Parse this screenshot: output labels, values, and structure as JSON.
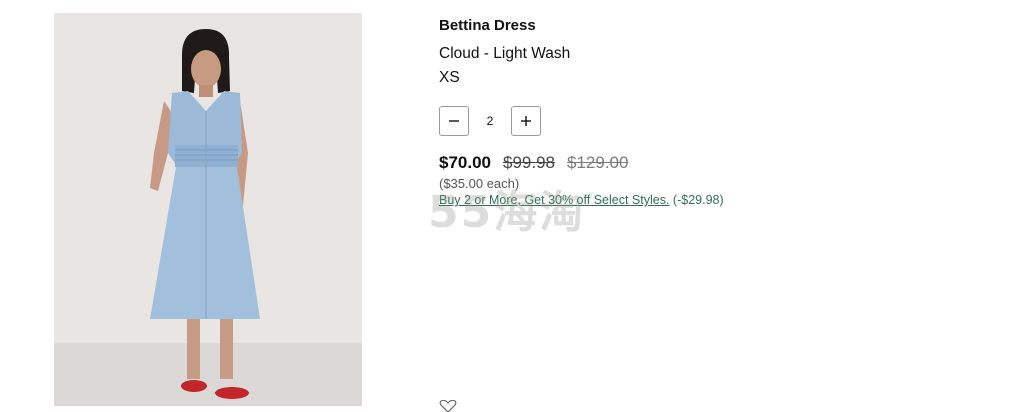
{
  "product": {
    "name": "Bettina Dress",
    "color": "Cloud - Light Wash",
    "size": "XS",
    "quantity": "2",
    "price_current": "$70.00",
    "price_was": "$99.98",
    "price_original": "$129.00",
    "price_each": "($35.00 each)",
    "promo_link": "Buy 2 or More, Get 30% off Select Styles.",
    "promo_savings": " (-$29.98)"
  },
  "watermark": "55海淘",
  "icons": {
    "decrease": "minus-icon",
    "increase": "plus-icon",
    "favorite": "heart-icon"
  },
  "colors": {
    "promo": "#2f6f52",
    "dress": "#9dbad8"
  }
}
